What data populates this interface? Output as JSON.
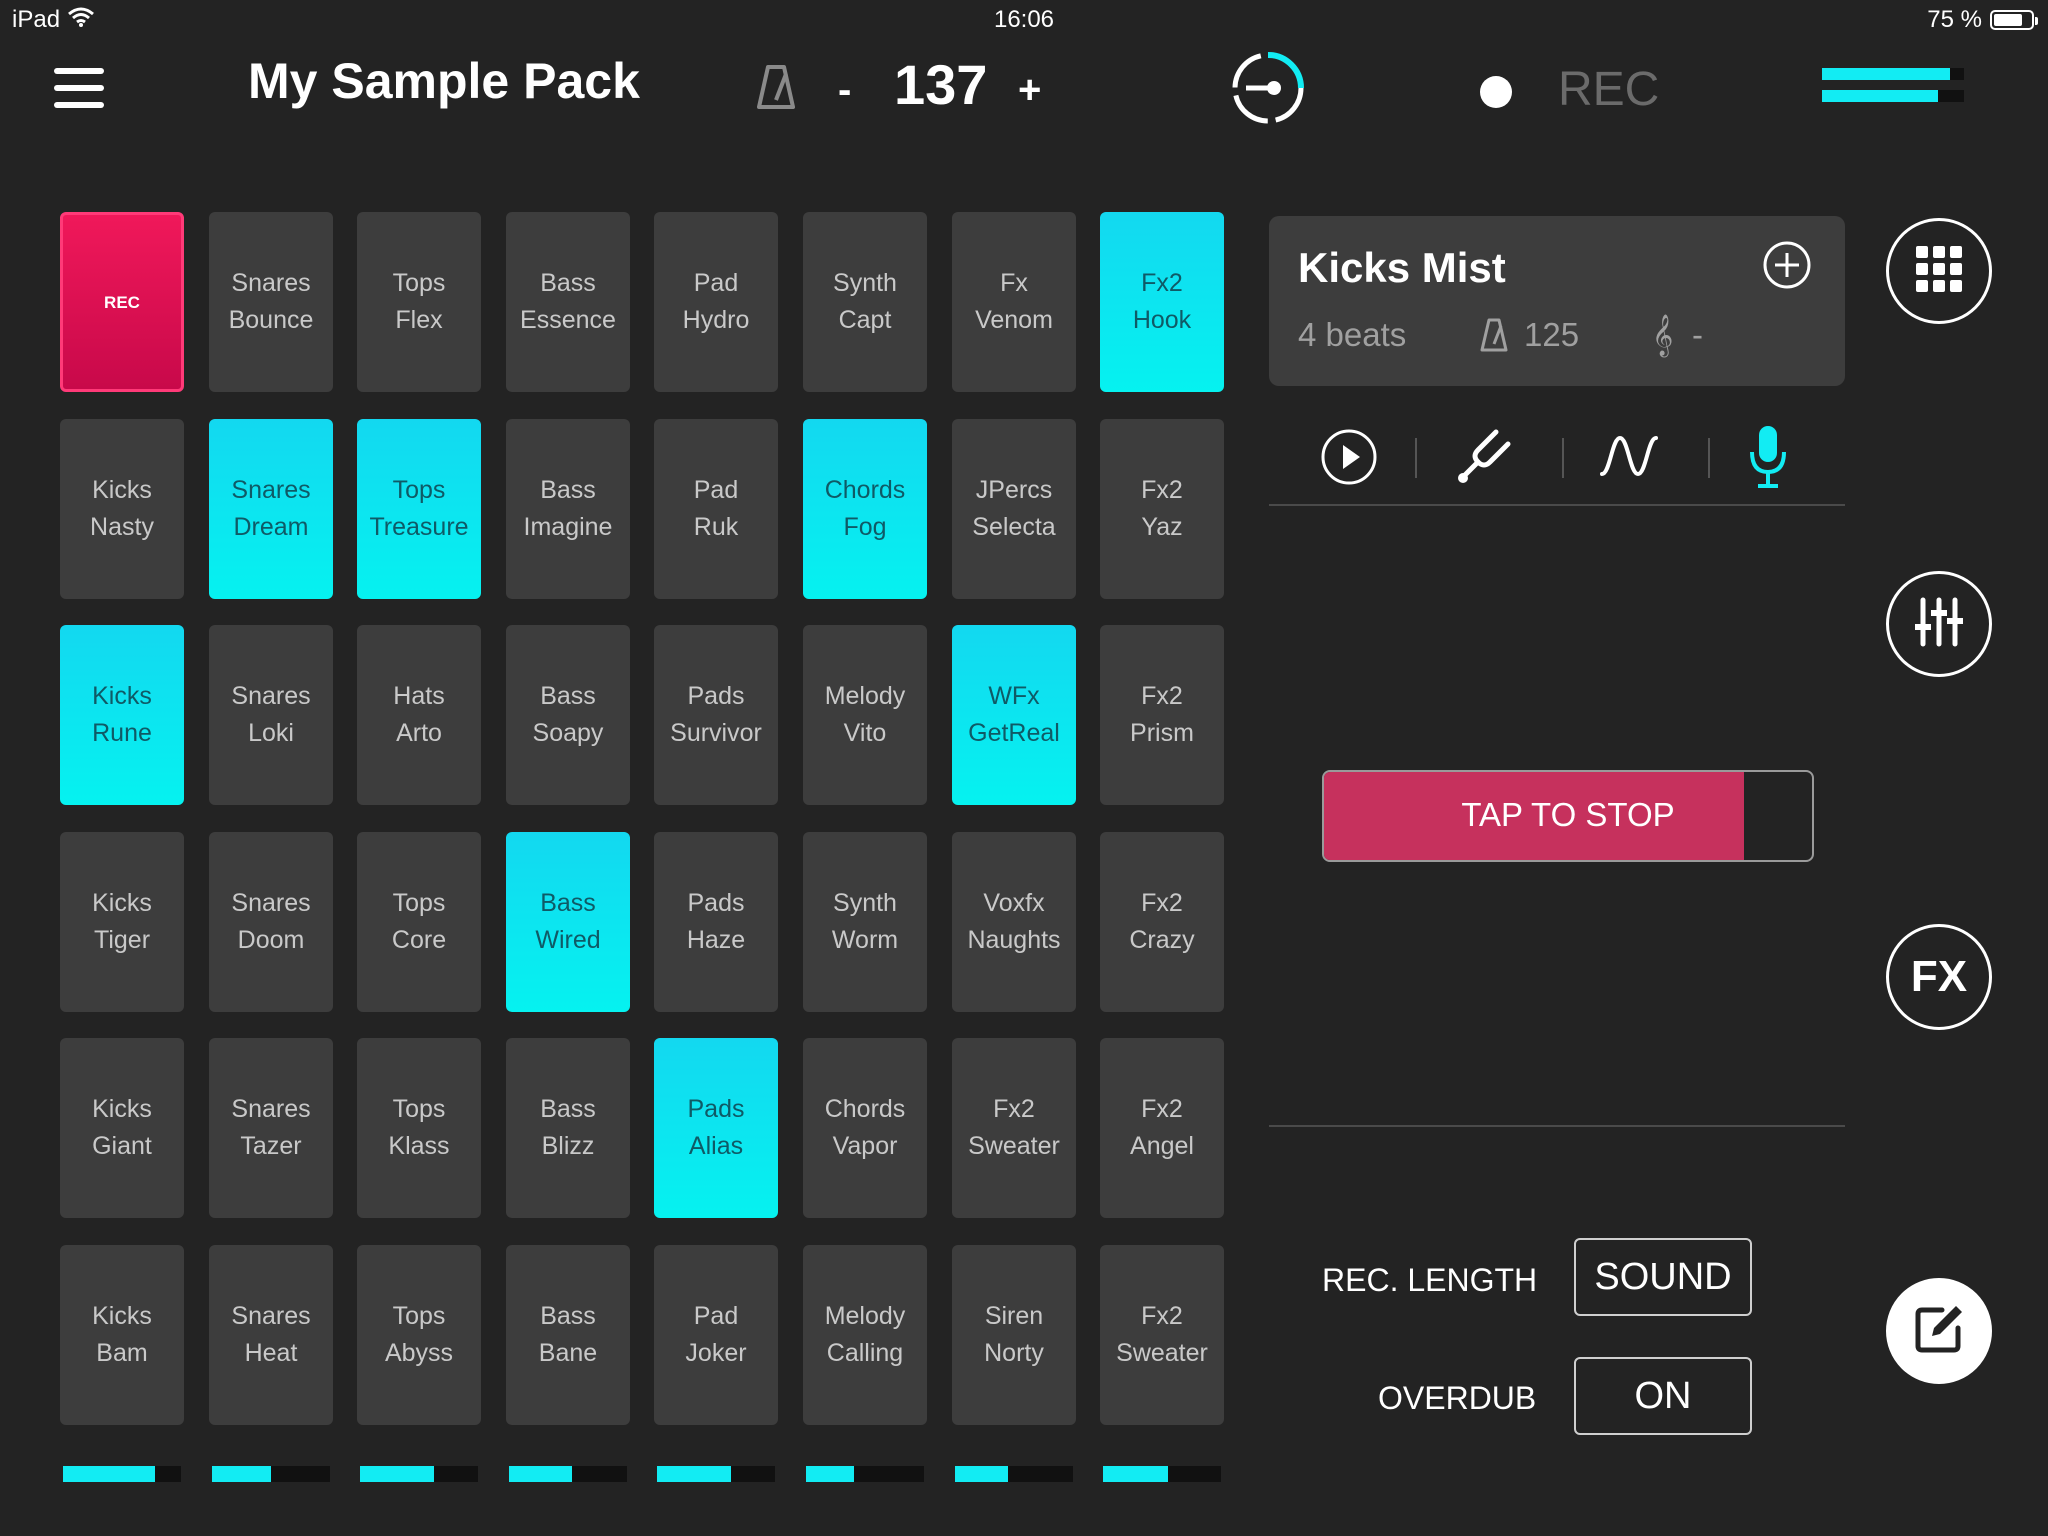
{
  "status": {
    "device": "iPad",
    "time": "16:06",
    "battery": "75 %"
  },
  "header": {
    "title": "My Sample Pack",
    "tempo_minus": "-",
    "tempo": "137",
    "tempo_plus": "+",
    "rec_label": "REC"
  },
  "pads": [
    [
      {
        "top": "REC",
        "bottom": "",
        "state": "rec"
      },
      {
        "top": "Snares",
        "bottom": "Bounce",
        "state": "idle"
      },
      {
        "top": "Tops",
        "bottom": "Flex",
        "state": "idle"
      },
      {
        "top": "Bass",
        "bottom": "Essence",
        "state": "idle"
      },
      {
        "top": "Pad",
        "bottom": "Hydro",
        "state": "idle"
      },
      {
        "top": "Synth",
        "bottom": "Capt",
        "state": "idle"
      },
      {
        "top": "Fx",
        "bottom": "Venom",
        "state": "idle"
      },
      {
        "top": "Fx2",
        "bottom": "Hook",
        "state": "active"
      }
    ],
    [
      {
        "top": "Kicks",
        "bottom": "Nasty",
        "state": "idle"
      },
      {
        "top": "Snares",
        "bottom": "Dream",
        "state": "active"
      },
      {
        "top": "Tops",
        "bottom": "Treasure",
        "state": "active"
      },
      {
        "top": "Bass",
        "bottom": "Imagine",
        "state": "idle"
      },
      {
        "top": "Pad",
        "bottom": "Ruk",
        "state": "idle"
      },
      {
        "top": "Chords",
        "bottom": "Fog",
        "state": "active"
      },
      {
        "top": "JPercs",
        "bottom": "Selecta",
        "state": "idle"
      },
      {
        "top": "Fx2",
        "bottom": "Yaz",
        "state": "idle"
      }
    ],
    [
      {
        "top": "Kicks",
        "bottom": "Rune",
        "state": "active"
      },
      {
        "top": "Snares",
        "bottom": "Loki",
        "state": "idle"
      },
      {
        "top": "Hats",
        "bottom": "Arto",
        "state": "idle"
      },
      {
        "top": "Bass",
        "bottom": "Soapy",
        "state": "idle"
      },
      {
        "top": "Pads",
        "bottom": "Survivor",
        "state": "idle"
      },
      {
        "top": "Melody",
        "bottom": "Vito",
        "state": "idle"
      },
      {
        "top": "WFx",
        "bottom": "GetReal",
        "state": "active"
      },
      {
        "top": "Fx2",
        "bottom": "Prism",
        "state": "idle"
      }
    ],
    [
      {
        "top": "Kicks",
        "bottom": "Tiger",
        "state": "idle"
      },
      {
        "top": "Snares",
        "bottom": "Doom",
        "state": "idle"
      },
      {
        "top": "Tops",
        "bottom": "Core",
        "state": "idle"
      },
      {
        "top": "Bass",
        "bottom": "Wired",
        "state": "active"
      },
      {
        "top": "Pads",
        "bottom": "Haze",
        "state": "idle"
      },
      {
        "top": "Synth",
        "bottom": "Worm",
        "state": "idle"
      },
      {
        "top": "Voxfx",
        "bottom": "Naughts",
        "state": "idle"
      },
      {
        "top": "Fx2",
        "bottom": "Crazy",
        "state": "idle"
      }
    ],
    [
      {
        "top": "Kicks",
        "bottom": "Giant",
        "state": "idle"
      },
      {
        "top": "Snares",
        "bottom": "Tazer",
        "state": "idle"
      },
      {
        "top": "Tops",
        "bottom": "Klass",
        "state": "idle"
      },
      {
        "top": "Bass",
        "bottom": "Blizz",
        "state": "idle"
      },
      {
        "top": "Pads",
        "bottom": "Alias",
        "state": "active"
      },
      {
        "top": "Chords",
        "bottom": "Vapor",
        "state": "idle"
      },
      {
        "top": "Fx2",
        "bottom": "Sweater",
        "state": "idle"
      },
      {
        "top": "Fx2",
        "bottom": "Angel",
        "state": "idle"
      }
    ],
    [
      {
        "top": "Kicks",
        "bottom": "Bam",
        "state": "idle"
      },
      {
        "top": "Snares",
        "bottom": "Heat",
        "state": "idle"
      },
      {
        "top": "Tops",
        "bottom": "Abyss",
        "state": "idle"
      },
      {
        "top": "Bass",
        "bottom": "Bane",
        "state": "idle"
      },
      {
        "top": "Pad",
        "bottom": "Joker",
        "state": "idle"
      },
      {
        "top": "Melody",
        "bottom": "Calling",
        "state": "idle"
      },
      {
        "top": "Siren",
        "bottom": "Norty",
        "state": "idle"
      },
      {
        "top": "Fx2",
        "bottom": "Sweater",
        "state": "idle"
      }
    ]
  ],
  "column_levels": [
    0.78,
    0.5,
    0.63,
    0.53,
    0.63,
    0.41,
    0.45,
    0.55
  ],
  "sample": {
    "name": "Kicks Mist",
    "beats": "4 beats",
    "bpm": "125",
    "key": "-"
  },
  "tap_to_stop": {
    "label": "TAP TO STOP",
    "progress": 0.86
  },
  "options": {
    "rec_length_label": "REC. LENGTH",
    "rec_length_value": "SOUND",
    "overdub_label": "OVERDUB",
    "overdub_value": "ON"
  },
  "sidebar": {
    "fx_label": "FX"
  },
  "colors": {
    "accent": "#12ecf3",
    "rec": "#e8135a",
    "stop": "#c6315d",
    "background": "#232323",
    "pad": "#3d3d3d"
  },
  "icons": [
    "hamburger-menu-icon",
    "metronome-icon",
    "sync-icon",
    "grid-icon",
    "mixer-icon",
    "edit-icon",
    "play-icon",
    "tuning-fork-icon",
    "waveform-icon",
    "microphone-icon",
    "add-icon",
    "treble-clef-icon",
    "wifi-icon",
    "battery-icon"
  ]
}
